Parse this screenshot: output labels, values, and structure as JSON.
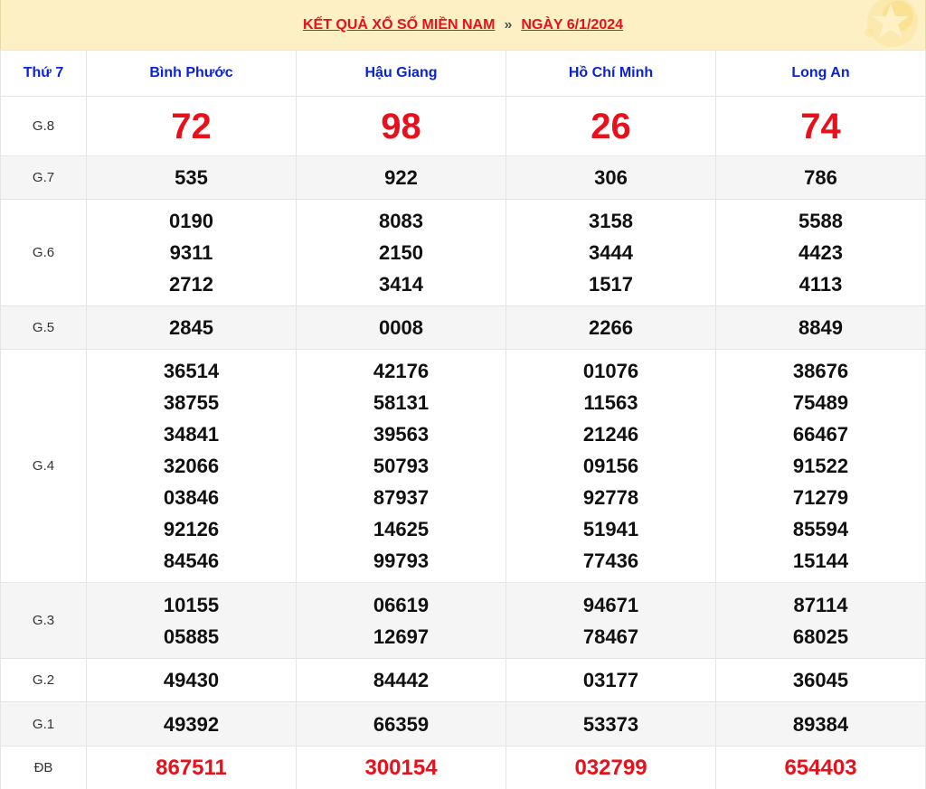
{
  "banner": {
    "title": "KẾT QUẢ XỔ SỐ MIỀN NAM",
    "separator": "»",
    "date_label": "NGÀY 6/1/2024"
  },
  "colors": {
    "banner_bg": "#fdf0c4",
    "link_red": "#e8101a",
    "header_blue": "#0a22d8",
    "alt_row": "#f5f5f5"
  },
  "header": {
    "day": "Thứ 7",
    "provinces": [
      "Bình Phước",
      "Hậu Giang",
      "Hồ Chí Minh",
      "Long An"
    ]
  },
  "prizes": {
    "g8": {
      "label": "G.8",
      "values": [
        [
          "72"
        ],
        [
          "98"
        ],
        [
          "26"
        ],
        [
          "74"
        ]
      ]
    },
    "g7": {
      "label": "G.7",
      "values": [
        [
          "535"
        ],
        [
          "922"
        ],
        [
          "306"
        ],
        [
          "786"
        ]
      ]
    },
    "g6": {
      "label": "G.6",
      "values": [
        [
          "0190",
          "9311",
          "2712"
        ],
        [
          "8083",
          "2150",
          "3414"
        ],
        [
          "3158",
          "3444",
          "1517"
        ],
        [
          "5588",
          "4423",
          "4113"
        ]
      ]
    },
    "g5": {
      "label": "G.5",
      "values": [
        [
          "2845"
        ],
        [
          "0008"
        ],
        [
          "2266"
        ],
        [
          "8849"
        ]
      ]
    },
    "g4": {
      "label": "G.4",
      "values": [
        [
          "36514",
          "38755",
          "34841",
          "32066",
          "03846",
          "92126",
          "84546"
        ],
        [
          "42176",
          "58131",
          "39563",
          "50793",
          "87937",
          "14625",
          "99793"
        ],
        [
          "01076",
          "11563",
          "21246",
          "09156",
          "92778",
          "51941",
          "77436"
        ],
        [
          "38676",
          "75489",
          "66467",
          "91522",
          "71279",
          "85594",
          "15144"
        ]
      ]
    },
    "g3": {
      "label": "G.3",
      "values": [
        [
          "10155",
          "05885"
        ],
        [
          "06619",
          "12697"
        ],
        [
          "94671",
          "78467"
        ],
        [
          "87114",
          "68025"
        ]
      ]
    },
    "g2": {
      "label": "G.2",
      "values": [
        [
          "49430"
        ],
        [
          "84442"
        ],
        [
          "03177"
        ],
        [
          "36045"
        ]
      ]
    },
    "g1": {
      "label": "G.1",
      "values": [
        [
          "49392"
        ],
        [
          "66359"
        ],
        [
          "53373"
        ],
        [
          "89384"
        ]
      ]
    },
    "db": {
      "label": "ĐB",
      "values": [
        [
          "867511"
        ],
        [
          "300154"
        ],
        [
          "032799"
        ],
        [
          "654403"
        ]
      ]
    }
  }
}
